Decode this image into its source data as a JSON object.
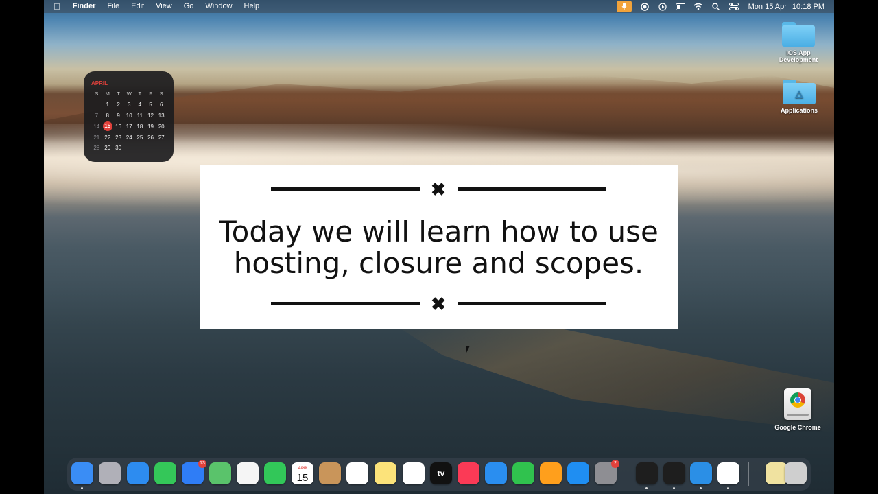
{
  "menubar": {
    "app_name": "Finder",
    "menus": [
      "File",
      "Edit",
      "View",
      "Go",
      "Window",
      "Help"
    ],
    "status_icons": [
      "microphone-icon",
      "record-icon",
      "play-icon",
      "battery-icon",
      "wifi-icon",
      "search-icon",
      "control-center-icon"
    ],
    "date": "Mon 15 Apr",
    "time": "10:18 PM"
  },
  "calendar_widget": {
    "month": "APRIL",
    "weekdays": [
      "S",
      "M",
      "T",
      "W",
      "T",
      "F",
      "S"
    ],
    "weeks": [
      [
        "",
        "1",
        "2",
        "3",
        "4",
        "5",
        "6"
      ],
      [
        "7",
        "8",
        "9",
        "10",
        "11",
        "12",
        "13"
      ],
      [
        "14",
        "15",
        "16",
        "17",
        "18",
        "19",
        "20"
      ],
      [
        "21",
        "22",
        "23",
        "24",
        "25",
        "26",
        "27"
      ],
      [
        "28",
        "29",
        "30",
        "",
        "",
        "",
        ""
      ]
    ],
    "today": "15"
  },
  "desktop_icons": {
    "ios_folder": "IOS App Development",
    "applications": "Applications",
    "chrome": "Google Chrome"
  },
  "overlay": {
    "line1": "Today we will learn how to use",
    "line2": "hosting, closure and scopes."
  },
  "dock": {
    "apps": [
      {
        "name": "Finder",
        "icon": "finder-icon",
        "color": "#3a8df5"
      },
      {
        "name": "Launchpad",
        "icon": "launchpad-icon",
        "color": "#b0b0b8"
      },
      {
        "name": "Safari",
        "icon": "safari-icon",
        "color": "#2d8cf0"
      },
      {
        "name": "Messages",
        "icon": "messages-icon",
        "color": "#34c759"
      },
      {
        "name": "Mail",
        "icon": "mail-icon",
        "color": "#2f7df6",
        "badge": "13"
      },
      {
        "name": "Maps",
        "icon": "maps-icon",
        "color": "#5ac36b"
      },
      {
        "name": "Photos",
        "icon": "photos-icon",
        "color": "#f5f5f5"
      },
      {
        "name": "FaceTime",
        "icon": "facetime-icon",
        "color": "#32c759"
      },
      {
        "name": "Calendar",
        "icon": "calendar-icon",
        "color": "#ffffff",
        "month": "APR",
        "day": "15"
      },
      {
        "name": "Contacts",
        "icon": "contacts-icon",
        "color": "#c9955a"
      },
      {
        "name": "Reminders",
        "icon": "reminders-icon",
        "color": "#ffffff"
      },
      {
        "name": "Notes",
        "icon": "notes-icon",
        "color": "#fce37a"
      },
      {
        "name": "Freeform",
        "icon": "freeform-icon",
        "color": "#ffffff"
      },
      {
        "name": "TV",
        "icon": "tv-icon",
        "color": "#111111",
        "label": "tv"
      },
      {
        "name": "Music",
        "icon": "music-icon",
        "color": "#fb3a56"
      },
      {
        "name": "Keynote",
        "icon": "keynote-icon",
        "color": "#2a8ef0"
      },
      {
        "name": "Numbers",
        "icon": "numbers-icon",
        "color": "#30c24e"
      },
      {
        "name": "Pages",
        "icon": "pages-icon",
        "color": "#ff9f1c"
      },
      {
        "name": "App Store",
        "icon": "app-store-icon",
        "color": "#1f8ef2"
      },
      {
        "name": "System Settings",
        "icon": "settings-icon",
        "color": "#8e8e93",
        "badge": "2"
      },
      {
        "name": "Activity Monitor",
        "icon": "terminal-green-icon",
        "color": "#1e1e1e"
      },
      {
        "name": "Terminal",
        "icon": "terminal-icon",
        "color": "#1e1e1e"
      },
      {
        "name": "Visual Studio Code",
        "icon": "vscode-icon",
        "color": "#2b8fe6"
      },
      {
        "name": "Google Chrome",
        "icon": "chrome-icon",
        "color": "#ffffff"
      },
      {
        "name": "Preview",
        "icon": "preview-icon",
        "color": "#f0e2a0"
      },
      {
        "name": "Trash",
        "icon": "trash-icon",
        "color": "#cfcfcf"
      }
    ]
  }
}
